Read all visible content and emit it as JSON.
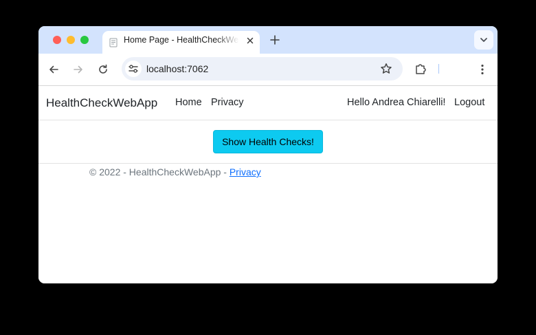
{
  "browser": {
    "tab_title": "Home Page - HealthCheckWebApp",
    "url": "localhost:7062"
  },
  "navbar": {
    "brand": "HealthCheckWebApp",
    "links": [
      "Home",
      "Privacy"
    ],
    "greeting": "Hello Andrea Chiarelli!",
    "logout": "Logout"
  },
  "main": {
    "button_label": "Show Health Checks!"
  },
  "footer": {
    "text": "© 2022 - HealthCheckWebApp - ",
    "link": "Privacy"
  },
  "colors": {
    "tab_strip": "#d3e3fd",
    "button": "#0dcaf0",
    "link": "#0d6efd"
  },
  "icons": [
    "back-arrow-icon",
    "forward-arrow-icon",
    "reload-icon",
    "site-info-icon",
    "bookmark-star-icon",
    "extensions-puzzle-icon",
    "kebab-menu-icon",
    "close-icon",
    "plus-icon",
    "chevron-down-icon"
  ]
}
